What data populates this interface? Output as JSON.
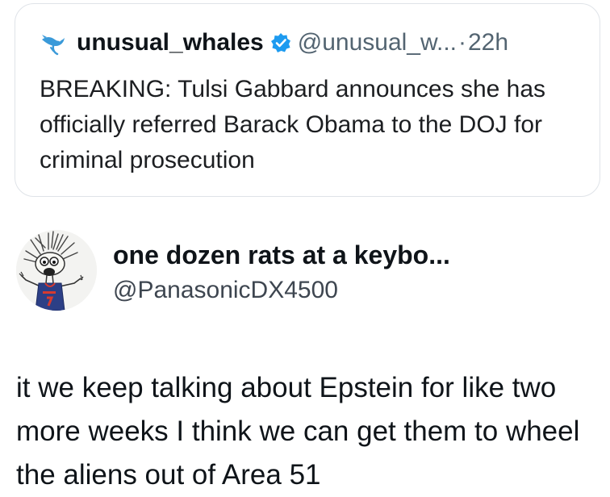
{
  "quoted_post": {
    "author_name": "unusual_whales",
    "handle": "@unusual_w...",
    "separator": "·",
    "time": "22h",
    "text": "BREAKING: Tulsi Gabbard announces she has officially referred Barack Obama to the DOJ for criminal prosecution",
    "avatar_icon": "whale-logo-icon",
    "verified_icon": "verified-badge-icon",
    "verified_color": "#1d9bf0",
    "accent_color": "#3a9ad9"
  },
  "post": {
    "author_name": "one dozen rats at a keybo...",
    "handle": "@PanasonicDX4500",
    "text": "it we keep talking about Epstein for like two more weeks I think we can get them to wheel the aliens out of Area 51",
    "avatar_icon": "cartoon-avatar-icon",
    "jersey_color": "#2c3f86"
  }
}
